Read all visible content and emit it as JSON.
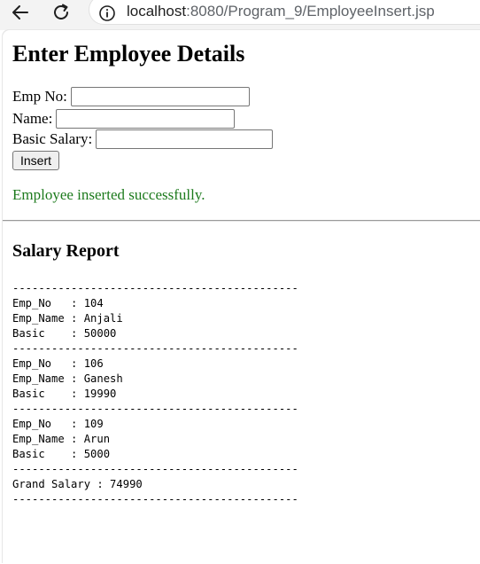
{
  "browser": {
    "url_host": "localhost",
    "url_path": ":8080/Program_9/EmployeeInsert.jsp",
    "back_icon": "arrow-left-icon",
    "reload_icon": "reload-icon",
    "info_icon": "info-icon"
  },
  "page": {
    "title": "Enter Employee Details",
    "form": {
      "empno_label": "Emp No:",
      "empno_value": "",
      "name_label": "Name:",
      "name_value": "",
      "salary_label": "Basic Salary:",
      "salary_value": "",
      "submit_label": "Insert"
    },
    "message": "Employee inserted successfully.",
    "message_color": "#1c7a1c",
    "report_title": "Salary Report",
    "report_lines": [
      "--------------------------------------------",
      "Emp_No   : 104",
      "Emp_Name : Anjali",
      "Basic    : 50000",
      "--------------------------------------------",
      "Emp_No   : 106",
      "Emp_Name : Ganesh",
      "Basic    : 19990",
      "--------------------------------------------",
      "Emp_No   : 109",
      "Emp_Name : Arun",
      "Basic    : 5000",
      "--------------------------------------------",
      "Grand Salary : 74990",
      "--------------------------------------------"
    ]
  }
}
